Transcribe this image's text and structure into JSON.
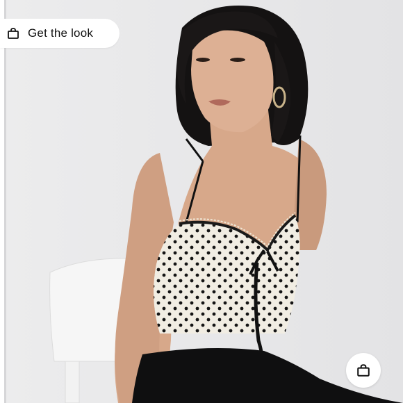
{
  "product_image": {
    "alt_icon": "model-photo"
  },
  "shop_the_look": {
    "label": "Get the look",
    "icon": "shopping-bag-icon"
  },
  "quick_add": {
    "icon": "shopping-bag-icon"
  },
  "colors": {
    "background": "#e9e9ea",
    "pill": "#ffffff",
    "text": "#111111"
  }
}
